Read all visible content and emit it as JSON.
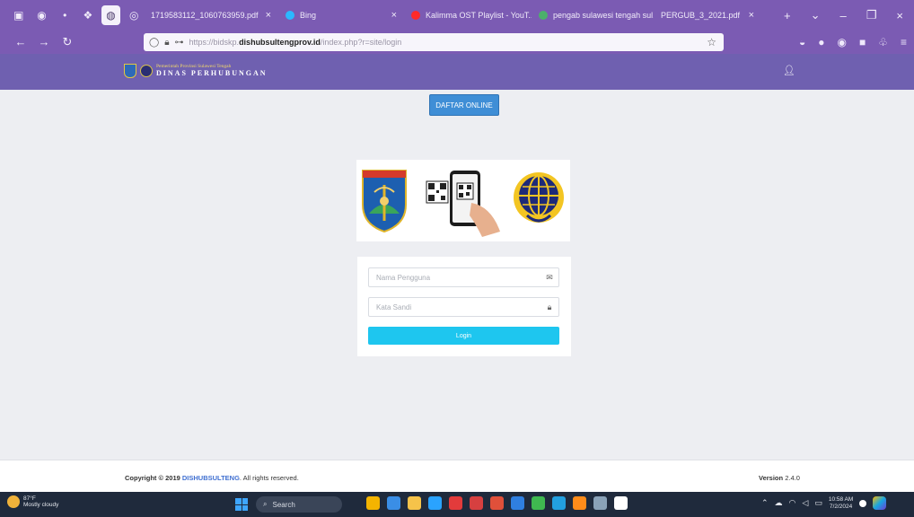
{
  "browser": {
    "tabs": [
      {
        "label": "1719583112_1060763959.pdf",
        "favicon_color": "#f1ecfa"
      },
      {
        "label": "Bing",
        "favicon_color": "#2bb8ff"
      },
      {
        "label": "Kalimma OST Playlist - YouT...",
        "favicon_color": "#ff2a2a"
      },
      {
        "label": "pengab sulawesi tengah sul...",
        "favicon_color": "#4cb06b"
      },
      {
        "label": "PERGUB_3_2021.pdf",
        "favicon_color": "#f1ecfa"
      }
    ],
    "url": {
      "prefix": "https://bidskp.",
      "domain": "dishubsultengprov.id",
      "path": "/index.php?r=site/login"
    }
  },
  "site": {
    "brand_line1": "Pemerintah Provinsi Sulawesi Tengah",
    "brand_line2": "DINAS PERHUBUNGAN"
  },
  "main": {
    "daftar_label": "DAFTAR ONLINE",
    "login": {
      "username_placeholder": "Nama Pengguna",
      "password_placeholder": "Kata Sandi",
      "submit_label": "Login"
    }
  },
  "footer": {
    "copyright_prefix": "Copyright © 2019",
    "copyright_brand": "DISHUBSULTENG",
    "copyright_suffix": ". All rights reserved.",
    "version_label": "Version",
    "version_value": "2.4.0"
  },
  "taskbar": {
    "weather_temp": "87°F",
    "weather_desc": "Mostly cloudy",
    "search_label": "Search",
    "time": "10:58 AM",
    "date": "7/2/2024",
    "app_colors": [
      "#f4b400",
      "#3a8ee6",
      "#f6c34a",
      "#2aa3ff",
      "#e33b3b",
      "#d64040",
      "#e0503a",
      "#2f7fe0",
      "#3fb950",
      "#22a0e0",
      "#ff8c1a",
      "#8aa2b8",
      "#ffffff"
    ]
  }
}
